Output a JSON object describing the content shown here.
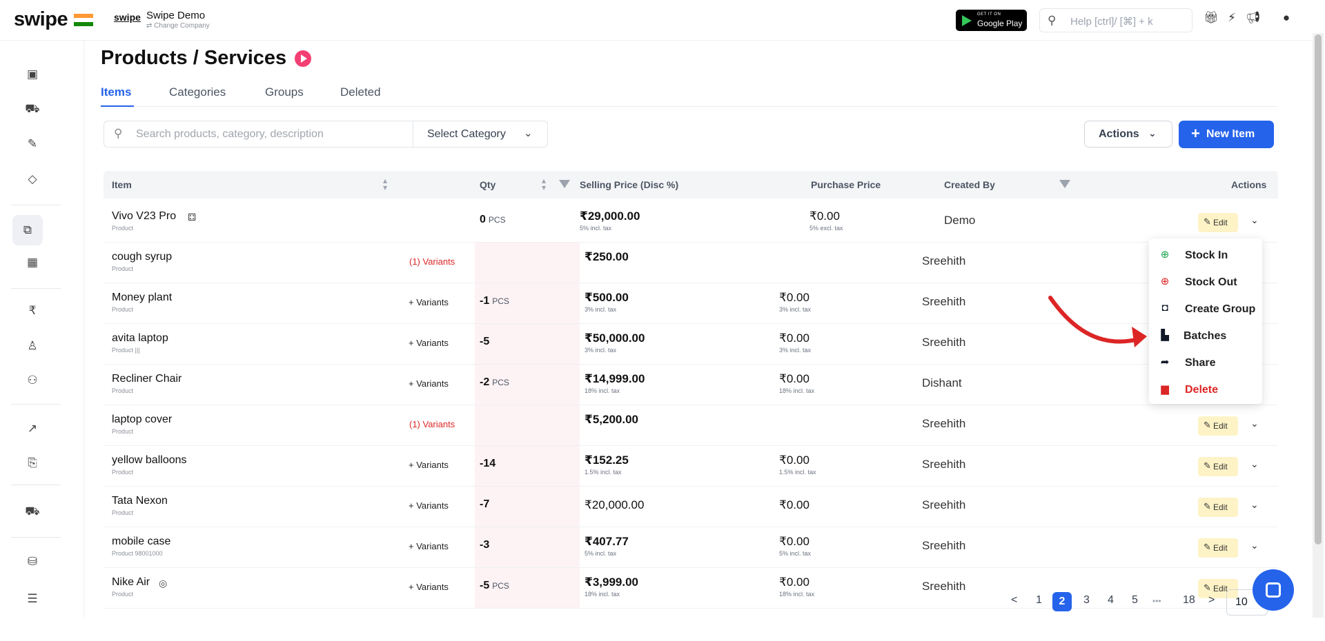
{
  "topbar": {
    "brand": "swipe",
    "company_logo": "swipe",
    "company_name": "Swipe Demo",
    "change_company": "⇄ Change Company",
    "gplay_small": "GET IT ON",
    "gplay_big": "Google Play",
    "help_placeholder": "Help [ctrl]/ [⌘] + k",
    "icons": [
      "gift-icon",
      "bolt-icon",
      "megaphone-icon",
      "user-icon"
    ]
  },
  "sidebar": {
    "items": [
      "cash-icon",
      "cart-icon",
      "pencil-icon",
      "tag-icon",
      "barcode-scan-icon",
      "warehouse-icon",
      "rupee-icon",
      "user-icon",
      "users-icon",
      "chart-icon",
      "report-icon",
      "truck-icon",
      "online-store-icon",
      "menu-icon"
    ]
  },
  "page": {
    "title": "Products / Services"
  },
  "tabs": [
    "Items",
    "Categories",
    "Groups",
    "Deleted"
  ],
  "toolbar": {
    "search_placeholder": "Search products, category, description",
    "select_category": "Select Category",
    "actions": "Actions",
    "new_item": "New Item"
  },
  "table": {
    "headers": {
      "item": "Item",
      "qty": "Qty",
      "selling": "Selling Price (Disc %)",
      "purchase": "Purchase Price",
      "created_by": "Created By",
      "actions": "Actions"
    },
    "edit_label": "Edit",
    "rows": [
      {
        "name": "Vivo V23 Pro",
        "type": "Product",
        "variants": "",
        "qty": "0",
        "unit": "PCS",
        "price": "₹29,000.00",
        "price_note": "5% incl. tax",
        "pprice": "₹0.00",
        "pprice_note": "5% excl. tax",
        "creator": "Demo"
      },
      {
        "name": "cough syrup",
        "type": "Product",
        "variants": "(1) Variants",
        "qty": "",
        "unit": "",
        "price": "₹250.00",
        "price_note": "",
        "pprice": "",
        "pprice_note": "",
        "creator": "Sreehith"
      },
      {
        "name": "Money plant",
        "type": "Product",
        "variants": "+ Variants",
        "qty": "-1",
        "unit": "PCS",
        "price": "₹500.00",
        "price_note": "3% incl. tax",
        "pprice": "₹0.00",
        "pprice_note": "3% incl. tax",
        "creator": "Sreehith"
      },
      {
        "name": "avita laptop",
        "type": "Product  |||",
        "variants": "+ Variants",
        "qty": "-5",
        "unit": "",
        "price": "₹50,000.00",
        "price_note": "3% incl. tax",
        "pprice": "₹0.00",
        "pprice_note": "3% incl. tax",
        "creator": "Sreehith"
      },
      {
        "name": "Recliner Chair",
        "type": "Product",
        "variants": "+ Variants",
        "qty": "-2",
        "unit": "PCS",
        "price": "₹14,999.00",
        "price_note": "18% incl. tax",
        "pprice": "₹0.00",
        "pprice_note": "18% incl. tax",
        "creator": "Dishant"
      },
      {
        "name": "laptop cover",
        "type": "Product",
        "variants": "(1) Variants",
        "qty": "",
        "unit": "",
        "price": "₹5,200.00",
        "price_note": "",
        "pprice": "",
        "pprice_note": "",
        "creator": "Sreehith"
      },
      {
        "name": "yellow balloons",
        "type": "Product",
        "variants": "+ Variants",
        "qty": "-14",
        "unit": "",
        "price": "₹152.25",
        "price_note": "1.5% incl. tax",
        "pprice": "₹0.00",
        "pprice_note": "1.5% incl. tax",
        "creator": "Sreehith"
      },
      {
        "name": "Tata Nexon",
        "type": "Product",
        "variants": "+ Variants",
        "qty": "-7",
        "unit": "",
        "price": "₹20,000.00",
        "price_note": "",
        "pprice": "₹0.00",
        "pprice_note": "",
        "creator": "Sreehith"
      },
      {
        "name": "mobile case",
        "type": "Product  98001000",
        "variants": "+ Variants",
        "qty": "-3",
        "unit": "",
        "price": "₹407.77",
        "price_note": "5% incl. tax",
        "pprice": "₹0.00",
        "pprice_note": "5% incl. tax",
        "creator": "Sreehith"
      },
      {
        "name": "Nike Air",
        "type": "Product",
        "variants": "+ Variants",
        "qty": "-5",
        "unit": "PCS",
        "price": "₹3,999.00",
        "price_note": "18% incl. tax",
        "pprice": "₹0.00",
        "pprice_note": "18% incl. tax",
        "creator": "Sreehith"
      }
    ]
  },
  "menu": {
    "items": [
      {
        "label": "Stock In",
        "icon": "arrow-down-circle-icon"
      },
      {
        "label": "Stock Out",
        "icon": "arrow-up-circle-icon"
      },
      {
        "label": "Create Group",
        "icon": "group-icon"
      },
      {
        "label": "Batches",
        "icon": "batches-icon"
      },
      {
        "label": "Share",
        "icon": "share-icon"
      },
      {
        "label": "Delete",
        "icon": "trash-icon"
      }
    ]
  },
  "pagination": {
    "prev": "<",
    "pages": [
      "1",
      "2",
      "3",
      "4",
      "5",
      "•••",
      "18"
    ],
    "current": "2",
    "next": ">",
    "page_size": "10"
  },
  "colors": {
    "accent": "#2563eb",
    "danger": "#dc2626",
    "edit_bg": "#fef3c7",
    "play": "#f43f73"
  }
}
